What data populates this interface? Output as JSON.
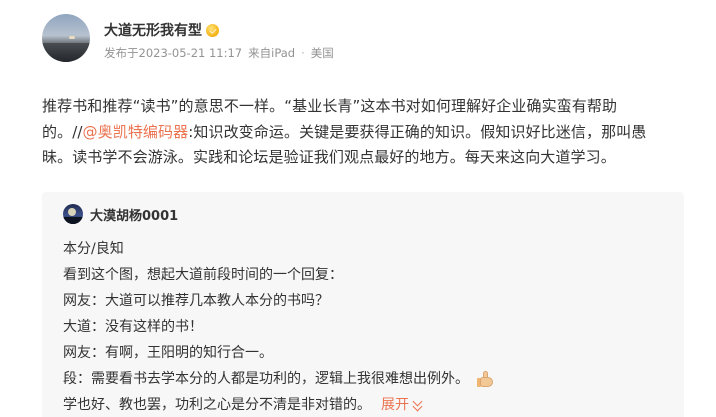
{
  "post": {
    "author": "大道无形我有型",
    "vip_badge": "gold-vip-icon",
    "meta": {
      "published": "发布于2023-05-21 11:17",
      "source": "来自iPad",
      "location": "美国"
    },
    "text": {
      "line1": "推荐书和推荐“读书”的意思不一样。“基业长青”这本书对如何理解好企业确实蛮有帮助",
      "line2_pre": "的。//",
      "mention": "@奥凯特编码器",
      "line2_post": ":知识改变命运。关键是要获得正确的知识。假知识好比迷信，那叫愚",
      "line3": "昧。读书学不会游泳。实践和论坛是验证我们观点最好的地方。每天来这向大道学习。"
    }
  },
  "quoted": {
    "author": "大漠胡杨0001",
    "lines": [
      "本分/良知",
      "看到这个图，想起大道前段时间的一个回复：",
      "网友：大道可以推荐几本教人本分的书吗？",
      "大道：没有这样的书！",
      "网友：有啊，王阳明的知行合一。",
      "段：需要看书去学本分的人都是功利的，逻辑上我很难想出例外。",
      "学也好、教也罢，功利之心是分不清是非对错的。"
    ],
    "expand_label": "展开"
  },
  "colors": {
    "accent": "#eb7350",
    "quote_bg": "#f7f7f7",
    "meta_text": "#939393"
  }
}
